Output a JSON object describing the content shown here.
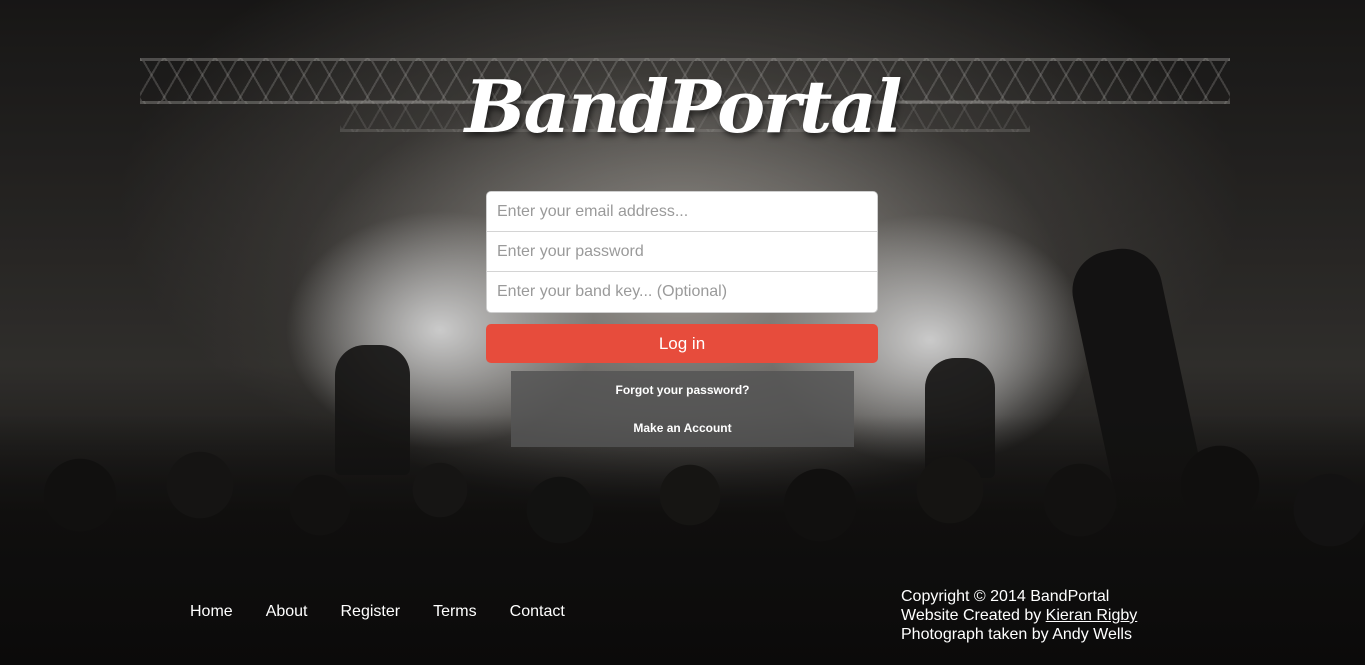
{
  "brand": {
    "logo_text": "BandPortal"
  },
  "login_form": {
    "email_placeholder": "Enter your email address...",
    "password_placeholder": "Enter your password",
    "band_key_placeholder": "Enter your band key... (Optional)",
    "login_button_label": "Log in"
  },
  "account_links": {
    "forgot_password": "Forgot your password?",
    "make_account": "Make an Account"
  },
  "footer": {
    "nav": {
      "home": "Home",
      "about": "About",
      "register": "Register",
      "terms": "Terms",
      "contact": "Contact"
    },
    "copyright": "Copyright © 2014 BandPortal",
    "created_by_prefix": "Website Created by ",
    "created_by_name": "Kieran Rigby",
    "photo_credit": "Photograph taken by Andy Wells"
  },
  "colors": {
    "accent": "#e74c3c",
    "links_panel": "#555555",
    "text": "#ffffff"
  }
}
